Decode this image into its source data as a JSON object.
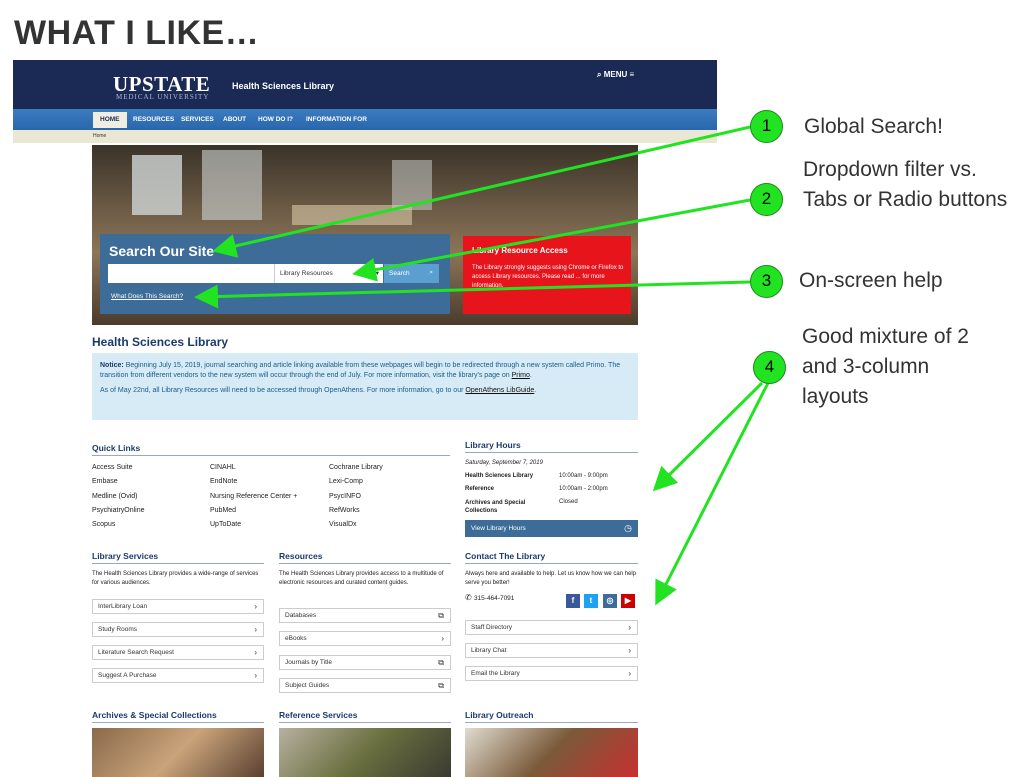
{
  "slide_title": "WHAT I LIKE…",
  "site": {
    "logo": "UPSTATE",
    "logo_sub": "MEDICAL UNIVERSITY",
    "name": "Health Sciences Library",
    "menu": "MENU",
    "nav": [
      "HOME",
      "RESOURCES",
      "SERVICES",
      "ABOUT",
      "HOW DO I?",
      "INFORMATION FOR"
    ],
    "breadcrumb": "Home"
  },
  "search": {
    "title": "Search Our Site",
    "filter_value": "Library Resources",
    "button": "Search",
    "help_link": "What Does This Search?"
  },
  "alert": {
    "title": "Library Resource Access",
    "text": "The Library strongly suggests using Chrome or Firefox to access Library resources. Please read ... for more information."
  },
  "main_heading": "Health Sciences Library",
  "notice": {
    "label": "Notice:",
    "text1": "Beginning July 15, 2019, journal searching and article linking available from these webpages will begin to be redirected through a new system called Primo. The transition from different vendors to the new system will occur through the end of July. For more information, visit the library's page on",
    "link1": "Primo",
    "text2": "As of May 22nd, all Library Resources will need to be accessed through OpenAthens. For more information, go to our",
    "link2": "OpenAthens LibGuide"
  },
  "quick_links": {
    "heading": "Quick Links",
    "items": [
      "Access Suite",
      "CINAHL",
      "Cochrane Library",
      "Embase",
      "EndNote",
      "Lexi-Comp",
      "Medline (Ovid)",
      "Nursing Reference Center +",
      "PsycINFO",
      "PsychiatryOnline",
      "PubMed",
      "RefWorks",
      "Scopus",
      "UpToDate",
      "VisualDx"
    ]
  },
  "hours": {
    "heading": "Library Hours",
    "date": "Saturday, September 7, 2019",
    "rows": [
      {
        "label": "Health Sciences Library",
        "value": "10:00am - 9:00pm"
      },
      {
        "label": "Reference",
        "value": "10:00am - 2:00pm"
      },
      {
        "label": "Archives and Special Collections",
        "value": "Closed"
      }
    ],
    "button": "View Library Hours"
  },
  "services": {
    "heading": "Library Services",
    "text": "The Health Sciences Library provides a wide-range of services for various audiences.",
    "items": [
      "InterLibrary Loan",
      "Study Rooms",
      "Literature Search Request",
      "Suggest A Purchase"
    ]
  },
  "resources": {
    "heading": "Resources",
    "text": "The Health Sciences Library provides access to a multitude of electronic resources and curated content guides.",
    "items": [
      "Databases",
      "eBooks",
      "Journals by Title",
      "Subject Guides"
    ]
  },
  "contact": {
    "heading": "Contact The Library",
    "text": "Always here and available to help. Let us know how we can help serve you better!",
    "phone": "315-464-7091",
    "items": [
      "Staff Directory",
      "Library Chat",
      "Email the Library"
    ]
  },
  "bottom": {
    "archives": "Archives & Special Collections",
    "reference": "Reference Services",
    "outreach": "Library Outreach"
  },
  "annotations": [
    {
      "num": "1",
      "text": "Global Search!"
    },
    {
      "num": "2",
      "text": "Dropdown filter vs. Tabs or Radio buttons"
    },
    {
      "num": "3",
      "text": "On-screen help"
    },
    {
      "num": "4",
      "text": "Good mixture of 2 and 3-column layouts"
    }
  ],
  "colors": {
    "annotation_green": "#22e322",
    "header_navy": "#1b2a55",
    "alert_red": "#e8141b"
  }
}
